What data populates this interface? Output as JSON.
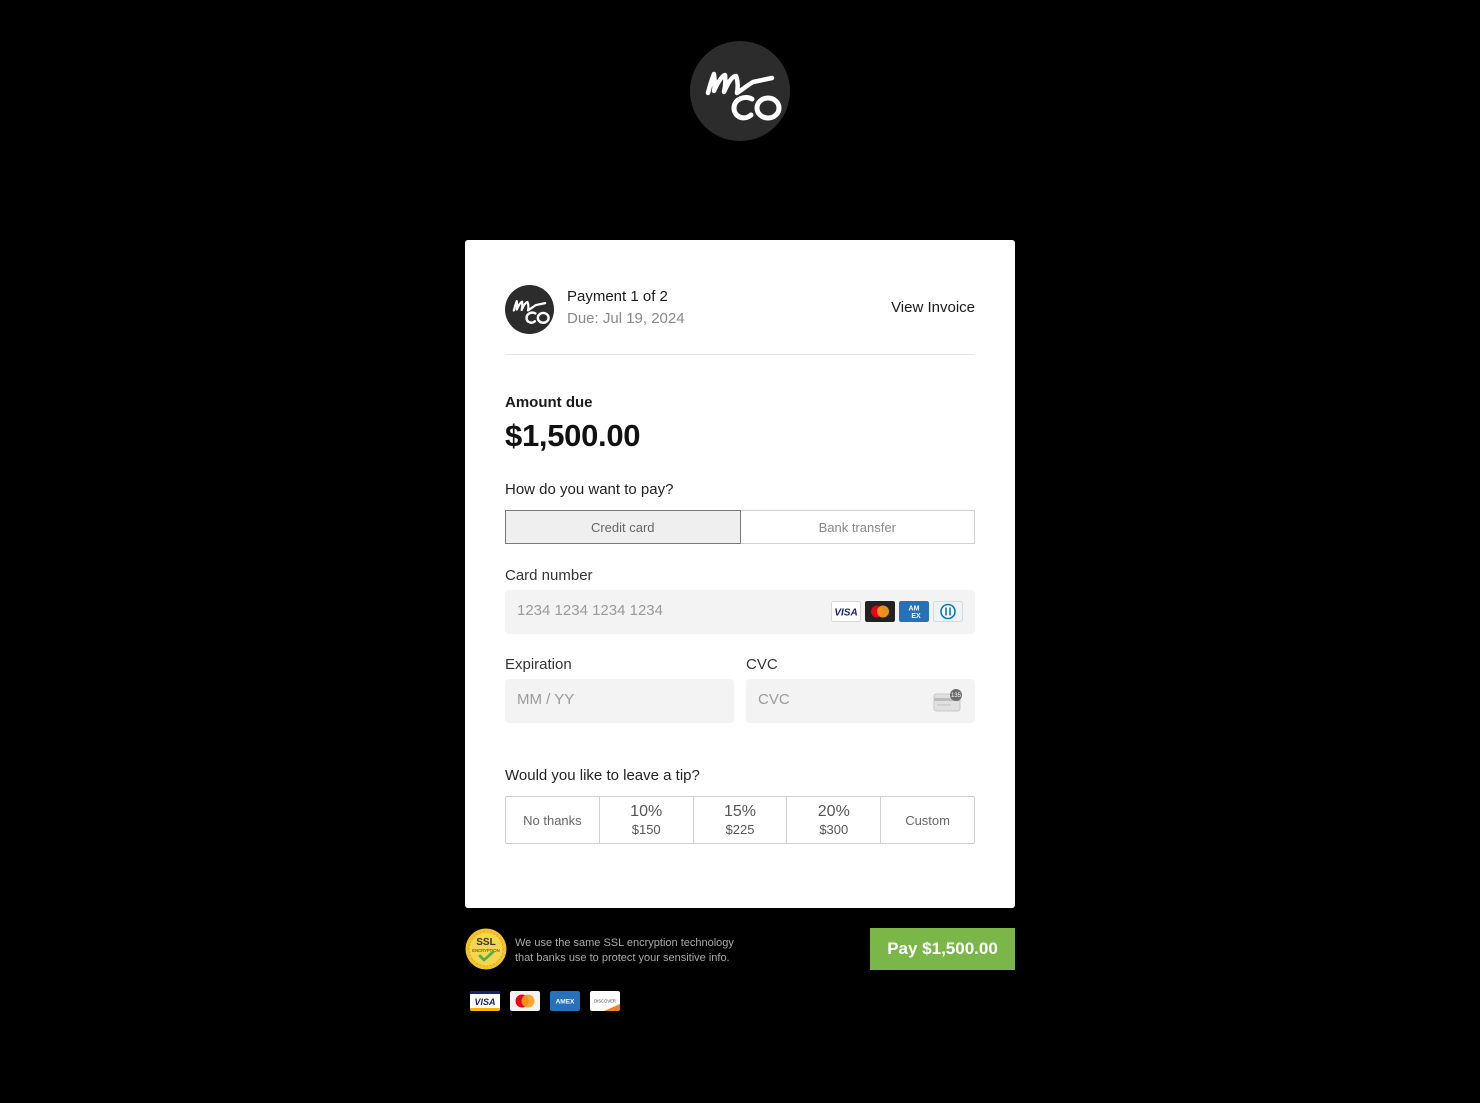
{
  "logo": {
    "icon": "mco-logo",
    "text": "mco"
  },
  "header": {
    "payment_title": "Payment 1 of 2",
    "due_date": "Due: Jul 19, 2024",
    "view_invoice": "View Invoice"
  },
  "amount": {
    "label": "Amount due",
    "value": "$1,500.00"
  },
  "payment_method": {
    "question": "How do you want to pay?",
    "options": [
      {
        "label": "Credit card",
        "selected": true
      },
      {
        "label": "Bank transfer",
        "selected": false
      }
    ]
  },
  "card": {
    "number_label": "Card number",
    "number_placeholder": "1234 1234 1234 1234",
    "brands": [
      "visa",
      "mastercard",
      "amex",
      "diners"
    ],
    "expiration_label": "Expiration",
    "expiration_placeholder": "MM / YY",
    "cvc_label": "CVC",
    "cvc_placeholder": "CVC",
    "cvc_icon_text": "135"
  },
  "tip": {
    "question": "Would you like to leave a tip?",
    "options": [
      {
        "label": "No thanks"
      },
      {
        "percent": "10%",
        "amount": "$150"
      },
      {
        "percent": "15%",
        "amount": "$225"
      },
      {
        "percent": "20%",
        "amount": "$300"
      },
      {
        "label": "Custom"
      }
    ]
  },
  "footer": {
    "ssl_badge_top": "SSL",
    "ssl_badge_bottom": "ENCRYPTION",
    "ssl_line1": "We use the same SSL encryption technology",
    "ssl_line2": "that banks use to protect your sensitive info.",
    "pay_button": "Pay $1,500.00",
    "brands": [
      "visa",
      "mastercard",
      "amex",
      "discover"
    ],
    "discover_text": "DISCOVER"
  },
  "colors": {
    "background": "#000000",
    "card": "#ffffff",
    "pay_button": "#7ab648",
    "logo_bg": "#2c2c2c"
  }
}
